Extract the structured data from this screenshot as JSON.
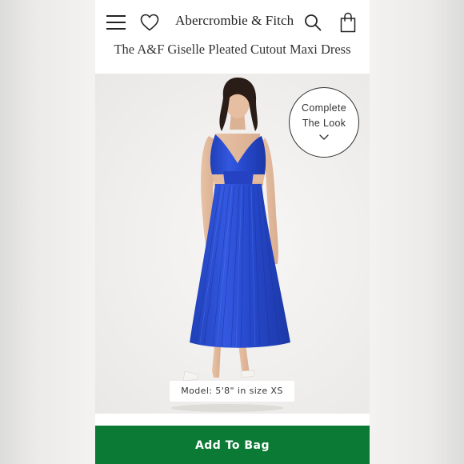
{
  "header": {
    "brand": "Abercrombie & Fitch",
    "menu_icon": "hamburger-menu-icon",
    "wishlist_icon": "heart-icon",
    "search_icon": "search-icon",
    "bag_icon": "shopping-bag-icon"
  },
  "product": {
    "title": "The A&F Giselle Pleated Cutout Maxi Dress",
    "dress_color": "#2a4fd6"
  },
  "complete_the_look": {
    "line1": "Complete",
    "line2": "The Look",
    "icon": "chevron-down-icon"
  },
  "model_caption": "Model: 5'8\" in size XS",
  "cta": {
    "add_to_bag_label": "Add To Bag",
    "color": "#0b7a34"
  }
}
